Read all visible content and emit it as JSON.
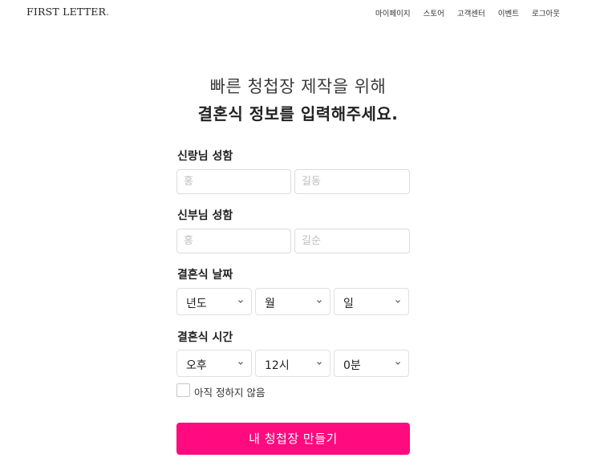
{
  "header": {
    "logo_text": "FIRST LETTER",
    "logo_dot": ".",
    "nav": [
      "마이페이지",
      "스토어",
      "고객센터",
      "이벤트",
      "로그아웃"
    ]
  },
  "hero": {
    "line1": "빠른 청첩장 제작을 위해",
    "line2": "결혼식 정보를 입력해주세요."
  },
  "groom": {
    "label": "신랑님 성함",
    "last_placeholder": "홍",
    "first_placeholder": "길동"
  },
  "bride": {
    "label": "신부님 성함",
    "last_placeholder": "홍",
    "first_placeholder": "길순"
  },
  "date": {
    "label": "결혼식 날짜",
    "year": "년도",
    "month": "월",
    "day": "일"
  },
  "time": {
    "label": "결혼식 시간",
    "ampm": "오후",
    "hour": "12시",
    "minute": "0분"
  },
  "undecided_label": "아직 정하지 않음",
  "submit_label": "내 청첩장 만들기",
  "colors": {
    "accent": "#ff0a7f",
    "border": "#dcdcdc",
    "placeholder": "#bdbdbd"
  }
}
